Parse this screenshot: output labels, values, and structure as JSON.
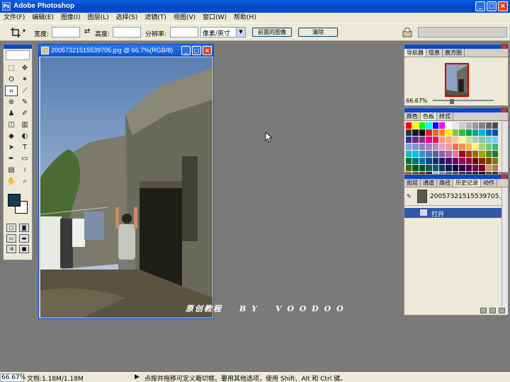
{
  "window": {
    "title": "Adobe Photoshop"
  },
  "menu": [
    "文件(F)",
    "编辑(E)",
    "图像(I)",
    "图层(L)",
    "选择(S)",
    "滤镜(T)",
    "视图(V)",
    "窗口(W)",
    "帮助(H)"
  ],
  "options": {
    "width_label": "宽度:",
    "height_label": "高度:",
    "resolution_label": "分辨率:",
    "unit_value": "像素/英寸",
    "front_image_button": "前面的图像",
    "clear_button": "清除"
  },
  "document": {
    "title": "20057321515539705.jpg @ 66.7%(RGB/8)"
  },
  "watermark": {
    "part1": "原创教程",
    "part2": "B Y",
    "part3": "V O O D O O"
  },
  "navigator": {
    "tabs": [
      "导航器",
      "信息",
      "直方图"
    ],
    "zoom": "66.67%"
  },
  "swatches_panel": {
    "tabs": [
      "颜色",
      "色板",
      "样式"
    ]
  },
  "history": {
    "tabs": [
      "图层",
      "通道",
      "路径",
      "历史记录",
      "动作"
    ],
    "snapshot_label": "20057321515539705.j...",
    "state_label": "打开"
  },
  "status": {
    "zoom": "66.67%",
    "doc_size": "文档:1.18M/1.18M",
    "hint": "点按并拖移可定义裁切框。要用其他选项，使用 Shift、Alt 和 Ctrl 键。"
  },
  "colors": {
    "foreground": "#1d3a55",
    "titlebar": "#0a4ed0",
    "selection": "#3157a7"
  },
  "swatch_colors": [
    "#ff0000",
    "#ffff00",
    "#00ff00",
    "#00ffff",
    "#0000ff",
    "#ff00ff",
    "#ffffff",
    "#e6e6e6",
    "#cccccc",
    "#b3b3b3",
    "#999999",
    "#808080",
    "#666666",
    "#4d4d4d",
    "#333333",
    "#1a1a1a",
    "#000000",
    "#ed1c24",
    "#f26522",
    "#f7941d",
    "#fff200",
    "#8dc63f",
    "#39b54a",
    "#00a651",
    "#00a99d",
    "#00aeef",
    "#0072bc",
    "#0054a6",
    "#2e3192",
    "#662d91",
    "#92278f",
    "#ec008c",
    "#ed145b",
    "#f7977a",
    "#f9ad81",
    "#fdc68a",
    "#fff79a",
    "#c4df9b",
    "#a3d39c",
    "#82ca9d",
    "#7accc8",
    "#6dcff6",
    "#7da7d9",
    "#8393ca",
    "#8781bd",
    "#a187be",
    "#bc8dbf",
    "#f49ac2",
    "#f6989d",
    "#f26c4f",
    "#f68e56",
    "#fbaf5d",
    "#fff467",
    "#acd372",
    "#7cc576",
    "#3bb878",
    "#1abbb4",
    "#00bff3",
    "#438ccb",
    "#5574b9",
    "#605ca8",
    "#855fa8",
    "#a763a8",
    "#f06ea9",
    "#9e0b0f",
    "#a0410d",
    "#a36209",
    "#aba000",
    "#598527",
    "#197b30",
    "#007236",
    "#00746b",
    "#0076a3",
    "#004b80",
    "#003471",
    "#1b1464",
    "#440e62",
    "#630460",
    "#9e005d",
    "#9e0039",
    "#790000",
    "#7b2e00",
    "#7d4900",
    "#827b00",
    "#406618",
    "#005e20",
    "#005826",
    "#005952",
    "#005b7f",
    "#003663",
    "#002157",
    "#0d004c",
    "#32004b",
    "#4b0049",
    "#7b0046",
    "#7a0026",
    "#c69c6d",
    "#a67c52",
    "#8c6239",
    "#754c24",
    "#603913",
    "#3c2415",
    "#c7b299",
    "#998675",
    "#736357",
    "#534741",
    "#362f2d",
    "#2b2522",
    "#1d1a18",
    "#0f0e0d",
    "#5e3a1d",
    "#3b1f0a"
  ]
}
